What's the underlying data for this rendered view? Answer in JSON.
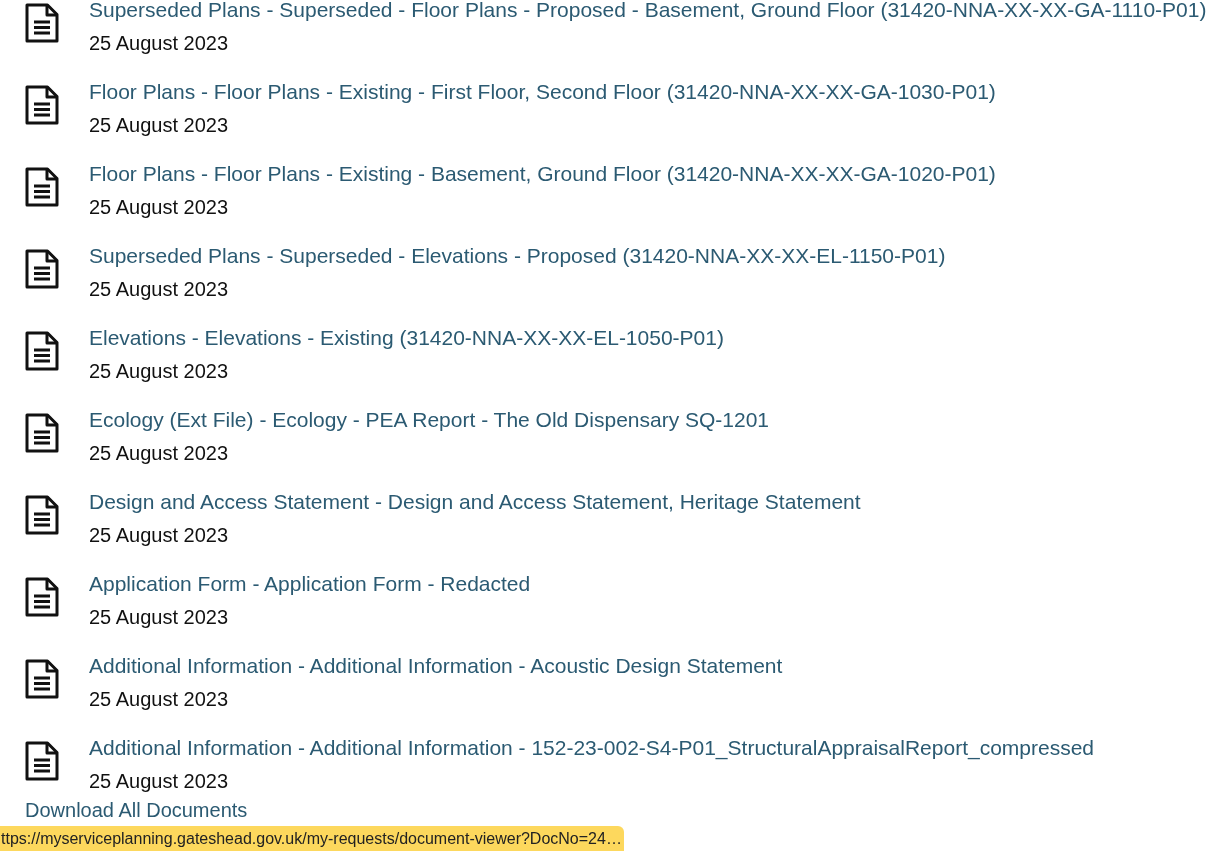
{
  "documents": [
    {
      "title": "Superseded Plans - Superseded - Floor Plans - Proposed - Basement, Ground Floor (31420-NNA-XX-XX-GA-1110-P01)",
      "date": "25 August 2023"
    },
    {
      "title": "Floor Plans - Floor Plans - Existing - First Floor, Second Floor (31420-NNA-XX-XX-GA-1030-P01)",
      "date": "25 August 2023"
    },
    {
      "title": "Floor Plans - Floor Plans - Existing - Basement, Ground Floor (31420-NNA-XX-XX-GA-1020-P01)",
      "date": "25 August 2023"
    },
    {
      "title": "Superseded Plans - Superseded - Elevations - Proposed (31420-NNA-XX-XX-EL-1150-P01)",
      "date": "25 August 2023"
    },
    {
      "title": "Elevations - Elevations - Existing (31420-NNA-XX-XX-EL-1050-P01)",
      "date": "25 August 2023"
    },
    {
      "title": "Ecology (Ext File) - Ecology - PEA Report - The Old Dispensary SQ-1201",
      "date": "25 August 2023"
    },
    {
      "title": "Design and Access Statement - Design and Access Statement, Heritage Statement",
      "date": "25 August 2023"
    },
    {
      "title": "Application Form - Application Form - Redacted",
      "date": "25 August 2023"
    },
    {
      "title": "Additional Information - Additional Information - Acoustic Design Statement",
      "date": "25 August 2023"
    },
    {
      "title": "Additional Information - Additional Information - 152-23-002-S4-P01_StructuralAppraisalReport_compressed",
      "date": "25 August 2023"
    }
  ],
  "download_all_link": "Download All Documents",
  "status_bar": {
    "url": "ttps://myserviceplanning.gateshead.gov.uk/my-requests/document-viewer?DocNo=24…"
  }
}
